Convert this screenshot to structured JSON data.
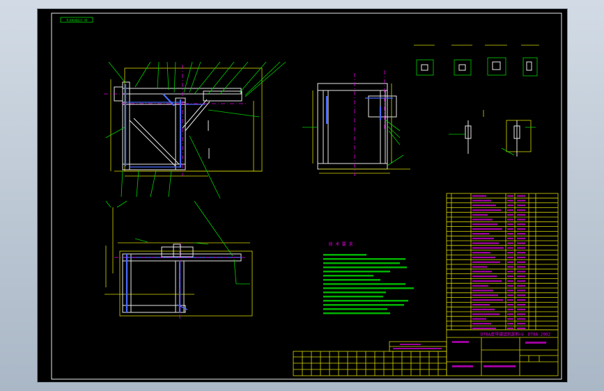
{
  "frame_tag": "专业机械设计 网",
  "notes_title": "技 术 要 求",
  "title_block": {
    "name": "DT8A皮带输送机卸料斗",
    "drawing_no": "DT8A-2002"
  },
  "colors": {
    "background": "#000000",
    "outline": "#e8e8e8",
    "dimension": "#d9d900",
    "leader": "#00d200",
    "text": "#e000e0",
    "centerline": "#e000e0",
    "hidden": "#4a6cff"
  }
}
